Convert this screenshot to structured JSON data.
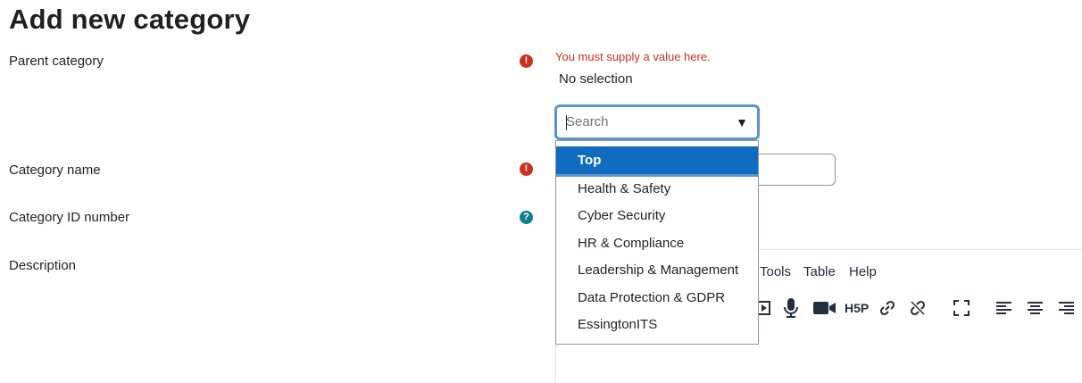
{
  "page": {
    "title": "Add new category"
  },
  "form": {
    "parent_category": {
      "label": "Parent category",
      "error": "You must supply a value here.",
      "selection": "No selection",
      "search_placeholder": "Search",
      "dropdown_arrow": "▼",
      "options": [
        "Top",
        "Health & Safety",
        "Cyber Security",
        "HR & Compliance",
        "Leadership & Management",
        "Data Protection & GDPR",
        "EssingtonITS"
      ],
      "highlighted_option": "Top"
    },
    "category_name": {
      "label": "Category name"
    },
    "category_id": {
      "label": "Category ID number"
    },
    "description": {
      "label": "Description"
    }
  },
  "icons": {
    "required": "!",
    "help": "?"
  },
  "editor": {
    "menus": [
      "Tools",
      "Table",
      "Help"
    ],
    "toolbar_icons": [
      "video-embed-icon",
      "microphone-icon",
      "camera-icon",
      "h5p-icon",
      "link-icon",
      "unlink-icon",
      "fullscreen-icon",
      "align-left-icon",
      "align-center-icon",
      "align-right-icon"
    ],
    "h5p_label": "H5P"
  },
  "colors": {
    "error": "#ca3120",
    "help": "#0f7f8e",
    "selected": "#0f6cbf",
    "focus_border": "#5b95cf"
  }
}
